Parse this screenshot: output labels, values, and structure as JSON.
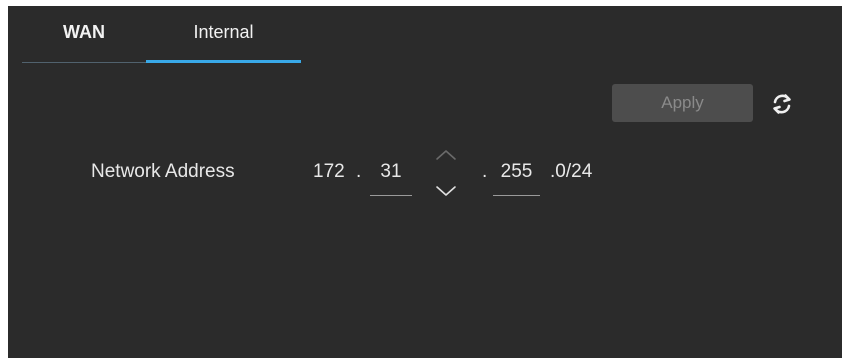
{
  "tabs": [
    {
      "label": "WAN",
      "active": false
    },
    {
      "label": "Internal",
      "active": true
    }
  ],
  "toolbar": {
    "apply_label": "Apply",
    "apply_enabled": false,
    "refresh_icon": "refresh-icon"
  },
  "network_address": {
    "label": "Network Address",
    "octet1": "172",
    "sep1": ".",
    "octet2": "31",
    "sep2": ".",
    "octet3": "255",
    "suffix": ".0/24"
  },
  "icons": {
    "stepper_up": "chevron-up-icon",
    "stepper_down": "chevron-down-icon"
  },
  "colors": {
    "background": "#2b2b2b",
    "active_tab_underline": "#39a9e8",
    "inactive_tab_underline": "#51626e",
    "text": "#e8e8e8",
    "disabled_button": "#4d4d4d",
    "disabled_button_text": "#8a8a8a"
  }
}
